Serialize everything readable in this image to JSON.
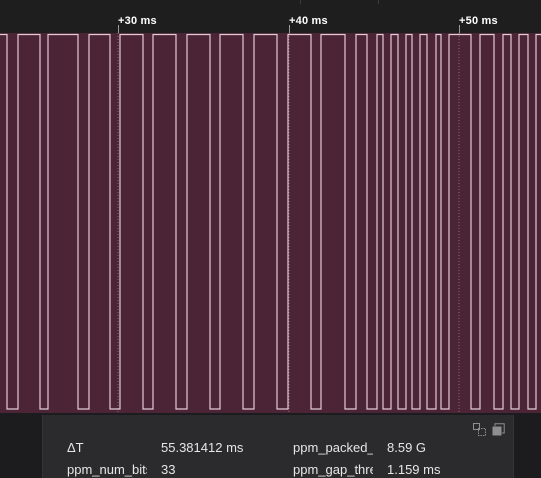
{
  "ruler": {
    "labels": [
      "+30 ms",
      "+40 ms",
      "+50 ms"
    ]
  },
  "colors": {
    "trace_fill": "#4b2535",
    "trace_line": "#e4c9d4",
    "background": "#1c1c1e",
    "panel": "#2b2b2d"
  },
  "measurement_panel": {
    "icons": [
      "split-view-icon",
      "copy-icon"
    ],
    "rows": [
      {
        "label": "ΔT",
        "value": "55.381412 ms",
        "label2": "ppm_packed_",
        "value2": "8.59 G"
      },
      {
        "label": "ppm_num_bits",
        "value": "33",
        "label2": "ppm_gap_thre",
        "value2": "1.159 ms"
      }
    ]
  }
}
